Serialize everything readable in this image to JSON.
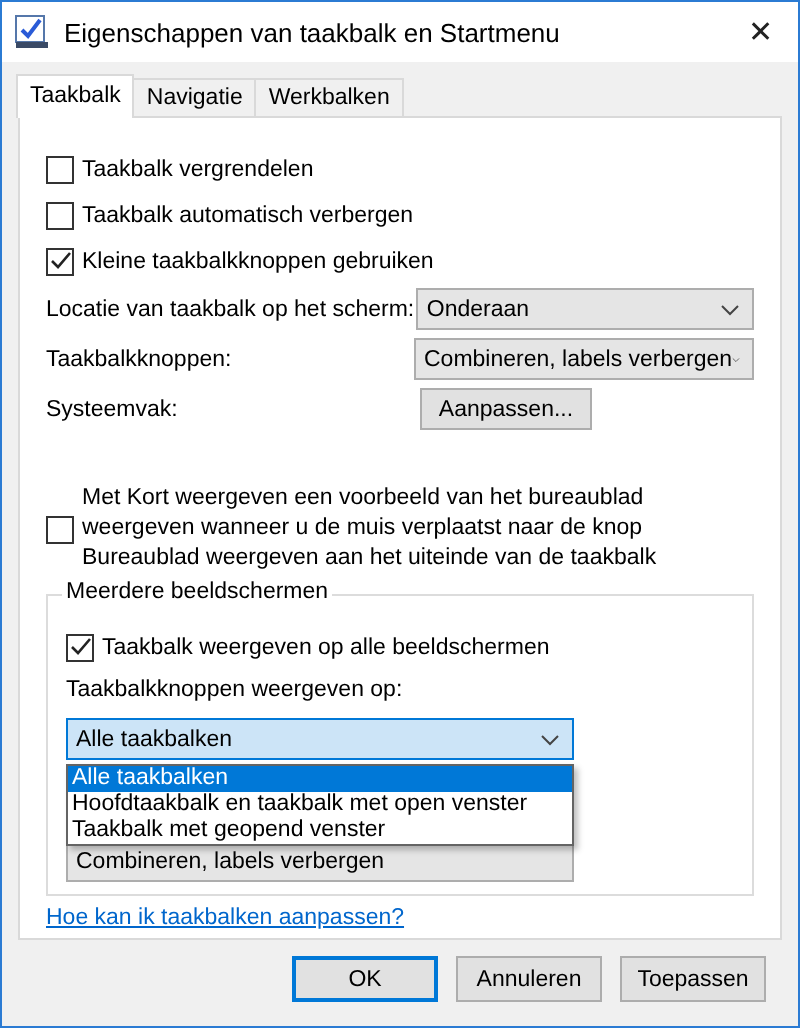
{
  "window": {
    "title": "Eigenschappen van taakbalk en Startmenu",
    "close": "✕"
  },
  "tabs": [
    {
      "label": "Taakbalk",
      "selected": true
    },
    {
      "label": "Navigatie",
      "selected": false
    },
    {
      "label": "Werkbalken",
      "selected": false
    }
  ],
  "options": [
    {
      "label": "Taakbalk vergrendelen",
      "checked": false
    },
    {
      "label": "Taakbalk automatisch verbergen",
      "checked": false
    },
    {
      "label": "Kleine taakbalkknoppen gebruiken",
      "checked": true
    }
  ],
  "location": {
    "label": "Locatie van taakbalk op het scherm:",
    "value": "Onderaan"
  },
  "buttons_combine": {
    "label": "Taakbalkknoppen:",
    "value": "Combineren, labels verbergen"
  },
  "tray": {
    "label": "Systeemvak:",
    "button": "Aanpassen..."
  },
  "peek": {
    "label": "Met Kort weergeven een voorbeeld van het bureaublad weergeven wanneer u de muis verplaatst naar de knop Bureaublad weergeven aan het uiteinde van de taakbalk",
    "checked": false
  },
  "multi": {
    "legend": "Meerdere beeldschermen",
    "show_all": {
      "label": "Taakbalk weergeven op alle beeldschermen",
      "checked": true
    },
    "show_on": {
      "label": "Taakbalkknoppen weergeven op:",
      "value": "Alle taakbalken",
      "options": [
        {
          "label": "Alle taakbalken",
          "selected": true
        },
        {
          "label": "Hoofdtaakbalk en taakbalk met open venster",
          "selected": false
        },
        {
          "label": "Taakbalk met geopend venster",
          "selected": false
        }
      ]
    },
    "combine_other": {
      "value": "Combineren, labels verbergen"
    }
  },
  "help_link": "Hoe kan ik taakbalken aanpassen?",
  "footer_buttons": [
    {
      "label": "OK",
      "default": true
    },
    {
      "label": "Annuleren",
      "default": false
    },
    {
      "label": "Toepassen",
      "default": false
    }
  ]
}
